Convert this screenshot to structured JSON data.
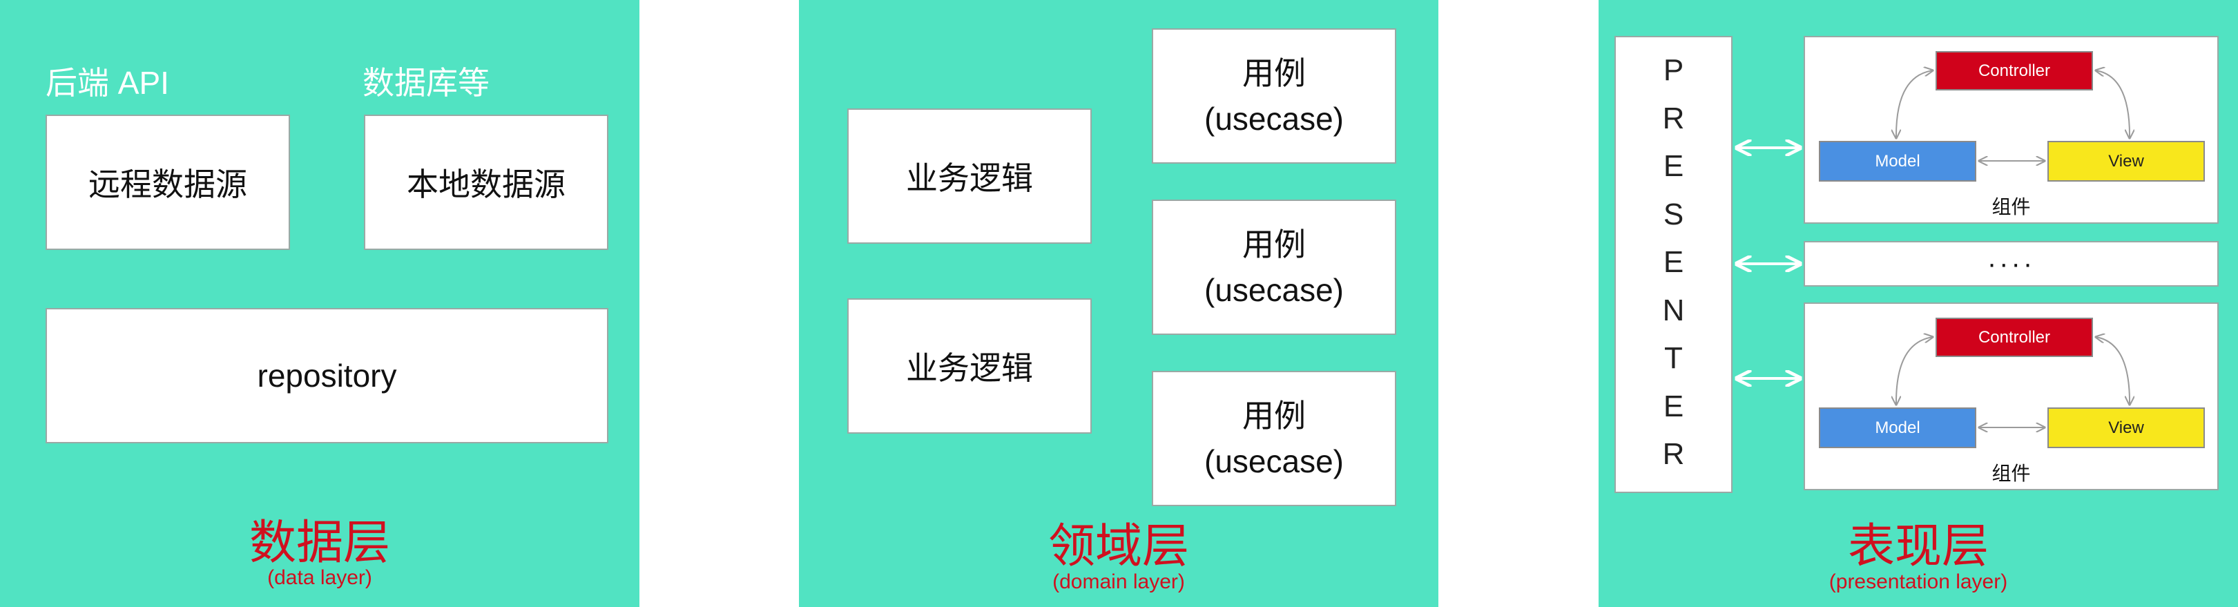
{
  "data_layer": {
    "source_label_remote": "后端 API",
    "source_label_local": "数据库等",
    "remote_source": "远程数据源",
    "local_source": "本地数据源",
    "repository": "repository",
    "title": "数据层",
    "subtitle": "(data layer)"
  },
  "domain_layer": {
    "business_logic": [
      "业务逻辑",
      "业务逻辑"
    ],
    "usecases": [
      {
        "line1": "用例",
        "line2": "(usecase)"
      },
      {
        "line1": "用例",
        "line2": "(usecase)"
      },
      {
        "line1": "用例",
        "line2": "(usecase)"
      }
    ],
    "title": "领域层",
    "subtitle": "(domain layer)"
  },
  "presentation_layer": {
    "presenter_letters": [
      "P",
      "R",
      "E",
      "S",
      "E",
      "N",
      "T",
      "E",
      "R"
    ],
    "components": [
      {
        "controller": "Controller",
        "model": "Model",
        "view": "View",
        "caption": "组件"
      },
      {
        "controller": "Controller",
        "model": "Model",
        "view": "View",
        "caption": "组件"
      }
    ],
    "ellipsis": "····",
    "title": "表现层",
    "subtitle": "(presentation layer)"
  },
  "colors": {
    "panel": "#51e3c2",
    "title": "#d0101f",
    "controller": "#d0021b",
    "model": "#4a90e2",
    "view": "#f8e71c"
  }
}
